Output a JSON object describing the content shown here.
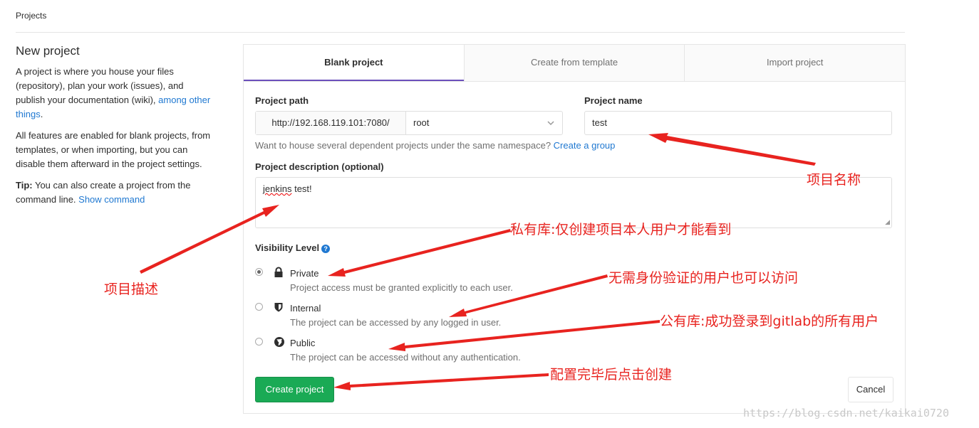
{
  "breadcrumb": "Projects",
  "left": {
    "title": "New project",
    "intro_text": "A project is where you house your files (repository), plan your work (issues), and publish your documentation (wiki), ",
    "intro_link": "among other things",
    "intro_end": ".",
    "features_text": "All features are enabled for blank projects, from templates, or when importing, but you can disable them afterward in the project settings.",
    "tip_label": "Tip:",
    "tip_text": " You can also create a project from the command line. ",
    "tip_link": "Show command"
  },
  "tabs": [
    {
      "label": "Blank project"
    },
    {
      "label": "Create from template"
    },
    {
      "label": "Import project"
    }
  ],
  "form": {
    "path_label": "Project path",
    "path_prefix": "http://192.168.119.101:7080/",
    "namespace": "root",
    "name_label": "Project name",
    "name_value": "test",
    "help_text": "Want to house several dependent projects under the same namespace? ",
    "help_link": "Create a group",
    "desc_label": "Project description (optional)",
    "desc_word1": "jenkins",
    "desc_word2": " test!",
    "visibility_label": "Visibility Level",
    "visibility": [
      {
        "title": "Private",
        "desc": "Project access must be granted explicitly to each user.",
        "icon": "lock-icon",
        "checked": true
      },
      {
        "title": "Internal",
        "desc": "The project can be accessed by any logged in user.",
        "icon": "shield-icon",
        "checked": false
      },
      {
        "title": "Public",
        "desc": "The project can be accessed without any authentication.",
        "icon": "globe-icon",
        "checked": false
      }
    ],
    "create_label": "Create project",
    "cancel_label": "Cancel"
  },
  "annotations": {
    "name": "项目名称",
    "desc": "项目描述",
    "private": "私有库:仅创建项目本人用户才能看到",
    "internal": "无需身份验证的用户也可以访问",
    "public": "公有库:成功登录到gitlab的所有用户",
    "create": "配置完毕后点击创建"
  },
  "watermark": "https://blog.csdn.net/kaikai0720",
  "colors": {
    "accent": "#6b4fbb",
    "link": "#1f78d1",
    "success": "#1aaa55",
    "annotation": "#e8231f"
  }
}
